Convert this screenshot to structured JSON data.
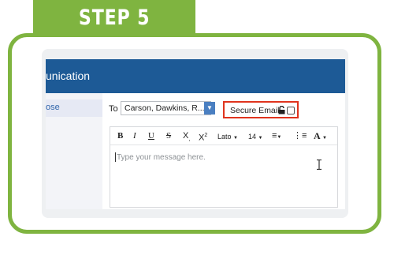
{
  "banner": {
    "step_label": "STEP 5"
  },
  "app": {
    "header_title": "unication",
    "sidebar": {
      "active_item": "ose"
    },
    "compose": {
      "to_label": "To",
      "to_value": "Carson, Dawkins, R...",
      "secure_email_label": "Secure Email",
      "secure_email_checked": false,
      "font_family": "Lato",
      "font_size": "14",
      "placeholder": "Type your message here."
    }
  },
  "colors": {
    "accent_green": "#7fb440",
    "header_blue": "#1d5a96",
    "highlight_red": "#e0341e"
  }
}
